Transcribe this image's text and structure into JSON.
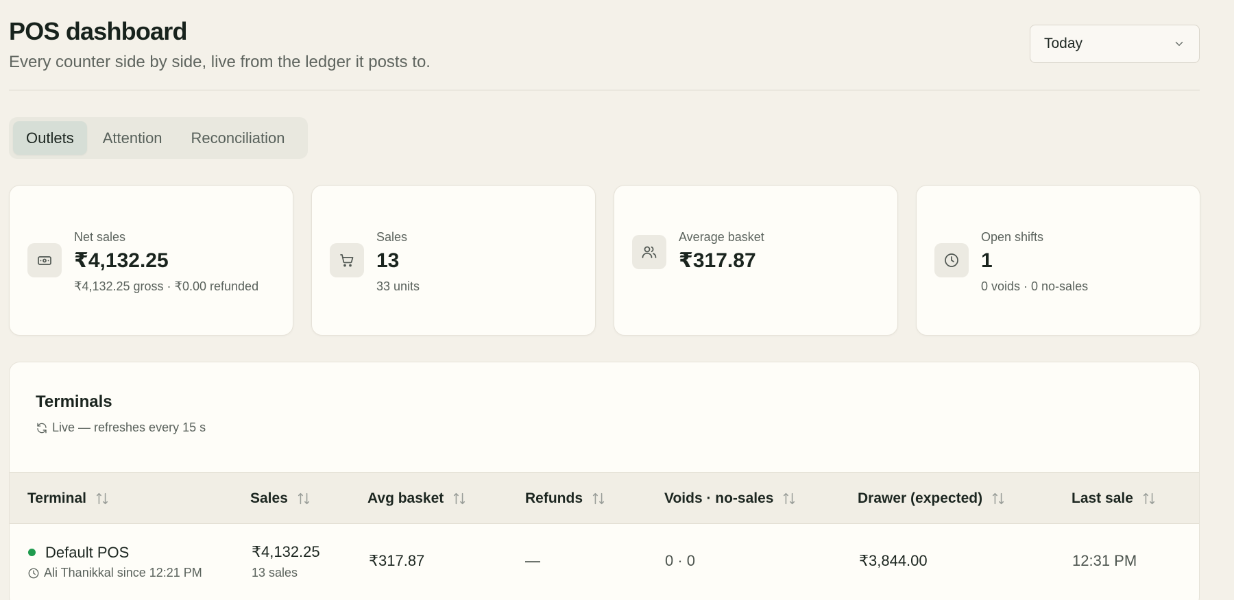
{
  "header": {
    "title": "POS dashboard",
    "subtitle": "Every counter side by side, live from the ledger it posts to.",
    "period": "Today"
  },
  "tabs": [
    {
      "label": "Outlets",
      "active": true
    },
    {
      "label": "Attention",
      "active": false
    },
    {
      "label": "Reconciliation",
      "active": false
    }
  ],
  "stats": [
    {
      "icon": "banknote-icon",
      "label": "Net sales",
      "value": "₹4,132.25",
      "sub": "₹4,132.25 gross · ₹0.00 refunded"
    },
    {
      "icon": "cart-icon",
      "label": "Sales",
      "value": "13",
      "sub": "33 units"
    },
    {
      "icon": "users-icon",
      "label": "Average basket",
      "value": "₹317.87",
      "sub": ""
    },
    {
      "icon": "clock-icon",
      "label": "Open shifts",
      "value": "1",
      "sub": "0 voids · 0 no-sales"
    }
  ],
  "terminals": {
    "title": "Terminals",
    "live_text": "Live — refreshes every 15 s",
    "columns": [
      "Terminal",
      "Sales",
      "Avg basket",
      "Refunds",
      "Voids · no-sales",
      "Drawer (expected)",
      "Last sale"
    ],
    "rows": [
      {
        "name": "Default POS",
        "operator": "Ali Thanikkal since 12:21 PM",
        "sales": "₹4,132.25",
        "sales_count": "13 sales",
        "avg_basket": "₹317.87",
        "refunds": "—",
        "voids": "0 · 0",
        "drawer": "₹3,844.00",
        "last_sale": "12:31 PM"
      }
    ]
  },
  "colors": {
    "accent": "#d6ded6",
    "status_online": "#1f9b4e",
    "background": "#f4f1e9"
  }
}
